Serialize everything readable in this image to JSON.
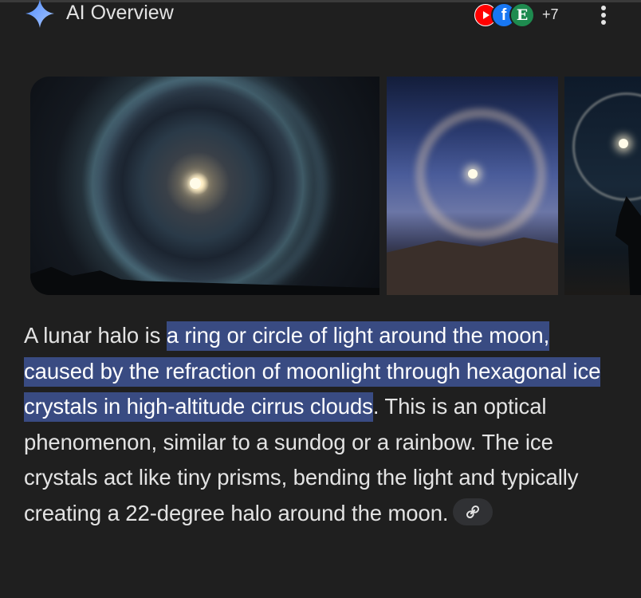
{
  "header": {
    "title": "AI Overview",
    "sources_more": "+7",
    "sources": [
      {
        "name": "youtube-source",
        "letter": "",
        "color": "#ff0000"
      },
      {
        "name": "facebook-source",
        "letter": "f",
        "color": "#1877f2"
      },
      {
        "name": "site-e-source",
        "letter": "E",
        "color": "#1e8b4f"
      }
    ]
  },
  "answer": {
    "intro": "A lunar halo is ",
    "highlight": "a ring or circle of light around the moon, caused by the refraction of moonlight through hexagonal ice crystals in high-altitude cirrus clouds",
    "rest": ". This is an optical phenomenon, similar to a sundog or a rainbow. The ice crystals act like tiny prisms, bending the light and typically creating a 22-degree halo around the moon."
  },
  "images": [
    {
      "name": "lunar-halo-photo-1"
    },
    {
      "name": "lunar-halo-observatory-photo"
    },
    {
      "name": "lunar-halo-tree-photo"
    }
  ],
  "colors": {
    "background": "#1f1f1f",
    "text": "#e3e3e3",
    "highlight": "#394b82",
    "sparkle": "#7aa7ff"
  }
}
